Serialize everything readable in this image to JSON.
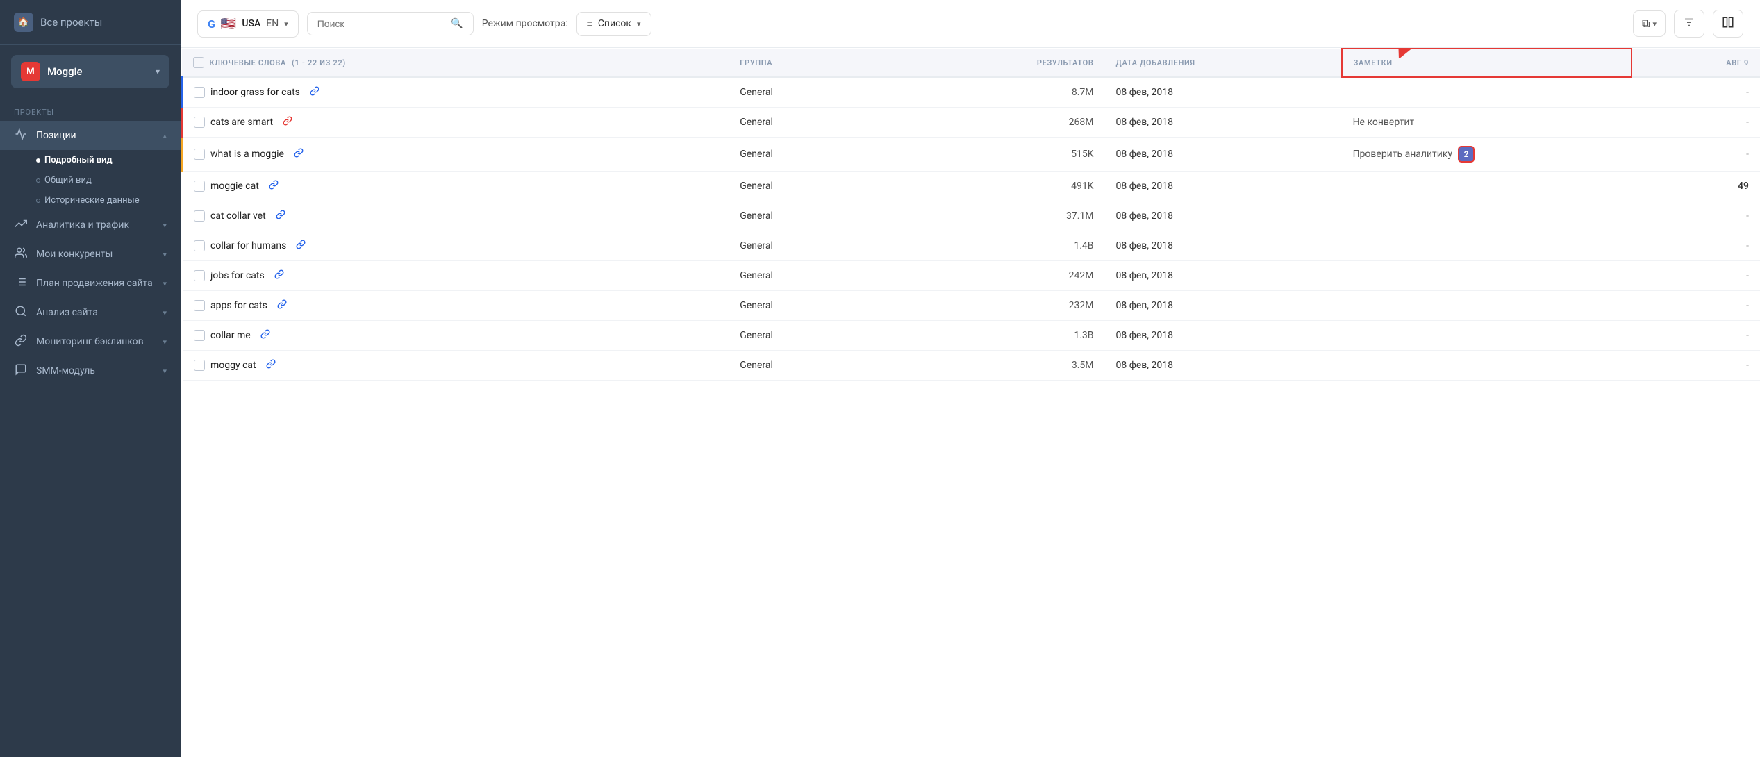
{
  "sidebar": {
    "all_projects_label": "Все проекты",
    "workspace": {
      "logo": "M",
      "name": "Moggie"
    },
    "section_label": "ПРОЕКТЫ",
    "items": [
      {
        "id": "positions",
        "icon": "📊",
        "label": "Позиции",
        "active": true,
        "has_submenu": true,
        "subitems": [
          {
            "id": "detailed",
            "label": "Подробный вид",
            "active": true
          },
          {
            "id": "general",
            "label": "Общий вид",
            "active": false
          },
          {
            "id": "history",
            "label": "Исторические данные",
            "active": false
          }
        ]
      },
      {
        "id": "analytics",
        "icon": "📈",
        "label": "Аналитика и трафик",
        "has_submenu": true
      },
      {
        "id": "competitors",
        "icon": "👥",
        "label": "Мои конкуренты",
        "has_submenu": true
      },
      {
        "id": "promotion",
        "icon": "≡",
        "label": "План продвижения сайта",
        "has_submenu": true
      },
      {
        "id": "site_analysis",
        "icon": "🔍",
        "label": "Анализ сайта",
        "has_submenu": true
      },
      {
        "id": "backlinks",
        "icon": "🔗",
        "label": "Мониторинг бэклинков",
        "has_submenu": true
      },
      {
        "id": "smm",
        "icon": "💬",
        "label": "SMM-модуль",
        "has_submenu": true
      }
    ]
  },
  "toolbar": {
    "search_engine": "Google",
    "flag": "🇺🇸",
    "country": "USA",
    "language": "EN",
    "search_placeholder": "Поиск",
    "view_mode_label": "Режим просмотра:",
    "view_mode_value": "Список"
  },
  "table": {
    "columns": {
      "keywords": "КЛЮЧЕВЫЕ СЛОВА",
      "keywords_count": "(1 - 22 ИЗ 22)",
      "group": "ГРУППА",
      "results": "РЕЗУЛЬТАТОВ",
      "date_added": "ДАТА ДОБАВЛЕНИЯ",
      "notes": "ЗАМЕТКИ",
      "aug": "АВГ 9"
    },
    "rows": [
      {
        "keyword": "indoor grass for cats",
        "link_color": "blue",
        "group": "General",
        "results": "8.7M",
        "date": "08 фев, 2018",
        "note": "",
        "aug": "-",
        "has_badge": false
      },
      {
        "keyword": "cats are smart",
        "link_color": "red",
        "group": "General",
        "results": "268M",
        "date": "08 фев, 2018",
        "note": "Не конвертит",
        "aug": "-",
        "has_badge": false
      },
      {
        "keyword": "what is a moggie",
        "link_color": "blue",
        "group": "General",
        "results": "515K",
        "date": "08 фев, 2018",
        "note": "Проверить аналитику",
        "aug": "-",
        "has_badge": true,
        "badge_count": "2"
      },
      {
        "keyword": "moggie cat",
        "link_color": "blue",
        "group": "General",
        "results": "491K",
        "date": "08 фев, 2018",
        "note": "",
        "aug": "49",
        "has_badge": false
      },
      {
        "keyword": "cat collar vet",
        "link_color": "blue",
        "group": "General",
        "results": "37.1M",
        "date": "08 фев, 2018",
        "note": "",
        "aug": "-",
        "has_badge": false
      },
      {
        "keyword": "collar for humans",
        "link_color": "blue",
        "group": "General",
        "results": "1.4B",
        "date": "08 фев, 2018",
        "note": "",
        "aug": "-",
        "has_badge": false
      },
      {
        "keyword": "jobs for cats",
        "link_color": "blue",
        "group": "General",
        "results": "242M",
        "date": "08 фев, 2018",
        "note": "",
        "aug": "-",
        "has_badge": false
      },
      {
        "keyword": "apps for cats",
        "link_color": "blue",
        "group": "General",
        "results": "232M",
        "date": "08 фев, 2018",
        "note": "",
        "aug": "-",
        "has_badge": false
      },
      {
        "keyword": "collar me",
        "link_color": "blue",
        "group": "General",
        "results": "1.3B",
        "date": "08 фев, 2018",
        "note": "",
        "aug": "-",
        "has_badge": false
      },
      {
        "keyword": "moggy cat",
        "link_color": "blue",
        "group": "General",
        "results": "3.5M",
        "date": "08 фев, 2018",
        "note": "",
        "aug": "-",
        "has_badge": false
      }
    ]
  }
}
